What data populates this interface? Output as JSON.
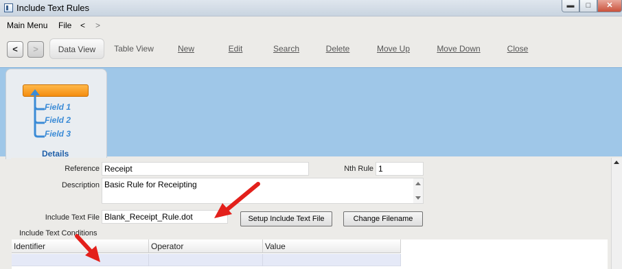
{
  "window": {
    "title": "Include Text Rules",
    "controls": {
      "minimize": "▬",
      "maximize": "□",
      "close": "✕"
    }
  },
  "menu": {
    "items": [
      "Main Menu",
      "File",
      "<",
      ">"
    ]
  },
  "toolbar": {
    "back": "<",
    "forward": ">",
    "buttons": {
      "data_view": "Data View",
      "table_view": "Table View",
      "new": "New",
      "edit": "Edit",
      "search": "Search",
      "delete": "Delete",
      "move_up": "Move Up",
      "move_down": "Move Down",
      "close": "Close"
    }
  },
  "panel": {
    "fields": [
      "Field 1",
      "Field 2",
      "Field 3"
    ],
    "details": "Details"
  },
  "form": {
    "reference_label": "Reference",
    "reference_value": "Receipt",
    "nth_rule_label": "Nth Rule",
    "nth_rule_value": "1",
    "description_label": "Description",
    "description_value": "Basic Rule for Receipting",
    "include_text_file_label": "Include Text File",
    "include_text_file_value": "Blank_Receipt_Rule.dot",
    "setup_button": "Setup Include Text File",
    "change_filename_button": "Change Filename"
  },
  "conditions": {
    "label": "Include Text Conditions",
    "columns": [
      "Identifier",
      "Operator",
      "Value"
    ]
  },
  "colors": {
    "header_blue": "#9fc7e8",
    "annotation_red": "#e3201b",
    "selected_row": "#e5e9f7",
    "orange": "#f48d10"
  }
}
